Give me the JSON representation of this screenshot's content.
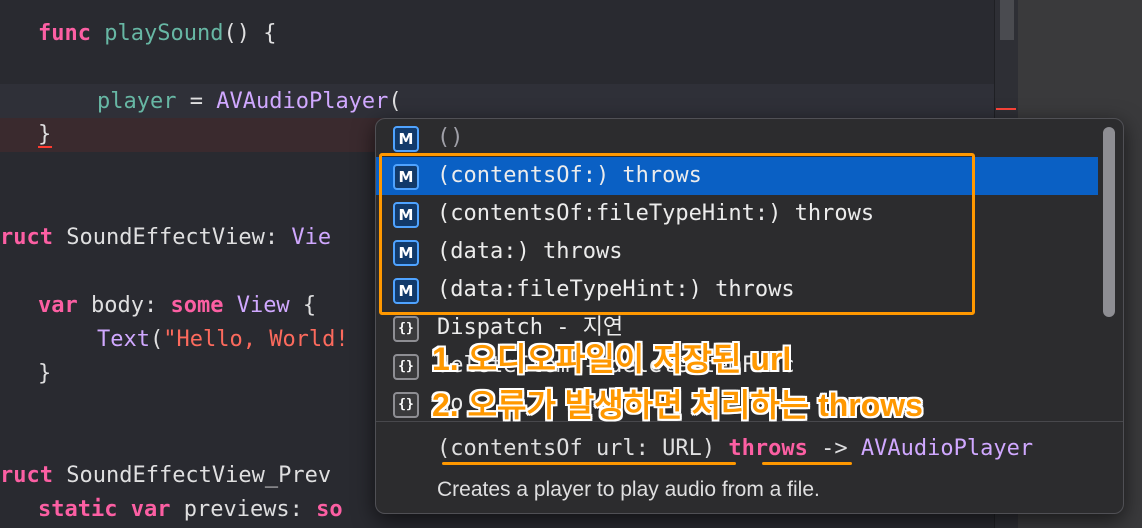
{
  "editor": {
    "lines": {
      "l1": {
        "kw": "func",
        "name": "playSound",
        "rest": "() {"
      },
      "l2": {
        "var": "player",
        "eq": " = ",
        "type": "AVAudioPlayer",
        "paren": "("
      },
      "l3": {
        "brace": "}"
      },
      "l4": {
        "kw": "ruct",
        "name": " SoundEffectView: ",
        "type": "Vie"
      },
      "l5": {
        "kw1": "var",
        "name": " body: ",
        "kw2": "some",
        "type": " View",
        "rest": " {"
      },
      "l6": {
        "fn": "Text",
        "p1": "(",
        "str": "\"Hello, World!"
      },
      "l7": {
        "brace": "}"
      },
      "l8": {
        "kw": "ruct",
        "name": " SoundEffectView_Prev"
      },
      "l9": {
        "kw1": "static",
        "kw2": " var",
        "name": " previews: ",
        "kw3": "so"
      }
    }
  },
  "completion": {
    "items": [
      {
        "badge": "M",
        "label": "()",
        "detail": ""
      },
      {
        "badge": "M",
        "label": "(contentsOf:)",
        "detail": " throws"
      },
      {
        "badge": "M",
        "label": "(contentsOf:fileTypeHint:)",
        "detail": " throws"
      },
      {
        "badge": "M",
        "label": "(data:)",
        "detail": " throws"
      },
      {
        "badge": "M",
        "label": "(data:fileTypeHint:)",
        "detail": " throws"
      },
      {
        "badge": "{}",
        "label": "Dispatch - 지연",
        "detail": ""
      },
      {
        "badge": "{}",
        "label": "deleteItem - deleteItemFunc",
        "detail": ""
      },
      {
        "badge": "{}",
        "label": "do",
        "detail": ""
      }
    ],
    "signature": {
      "params": "(contentsOf url: URL)",
      "throws": "throws",
      "arrow": " -> ",
      "returns": "AVAudioPlayer"
    },
    "description": "Creates a player to play audio from a file."
  },
  "annotations": {
    "line1": "1. 오디오파일이 저장된 url",
    "line2": "2. 오류가 발생하면 처리하는 throws"
  },
  "colors": {
    "accent": "#ff9800",
    "selection": "#0a60c4",
    "keyword": "#fc5fa3"
  }
}
